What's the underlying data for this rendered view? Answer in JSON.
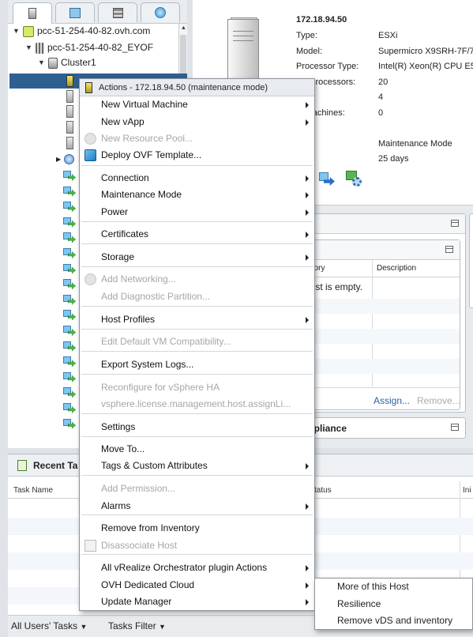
{
  "navigator": {
    "tabs": [
      {
        "name": "hosts-clusters-tab",
        "glyph": "▯"
      },
      {
        "name": "vms-templates-tab",
        "glyph": "◫"
      },
      {
        "name": "storage-tab",
        "glyph": "▤"
      },
      {
        "name": "networking-tab",
        "glyph": "◉"
      }
    ],
    "tree": {
      "vcenter": "pcc-51-254-40-82.ovh.com",
      "datacenter": "pcc-51-254-40-82_EYOF",
      "cluster": "Cluster1"
    }
  },
  "summary": {
    "host_ip": "172.18.94.50",
    "fields": [
      {
        "label": "Type:",
        "value": "ESXi"
      },
      {
        "label": "Model:",
        "value": "Supermicro X9SRH-7F/7T"
      },
      {
        "label": "Processor Type:",
        "value": "Intel(R) Xeon(R) CPU E5-"
      },
      {
        "label": "cal Processors:",
        "value": "20"
      },
      {
        "label": "",
        "value": "4"
      },
      {
        "label": "al Machines:",
        "value": "0"
      },
      {
        "label": "",
        "value": ""
      },
      {
        "label": "e:",
        "value": "Maintenance Mode"
      },
      {
        "label": "ne:",
        "value": "25 days"
      }
    ],
    "panel_list": {
      "col_category": "gory",
      "col_description": "Description",
      "empty_text": "list is empty.",
      "assign_link": "Assign...",
      "remove_link": "Remove..."
    },
    "compliance_label": "mpliance"
  },
  "tasks": {
    "title": "Recent Ta",
    "col_task_name": "Task Name",
    "col_status": "tatus",
    "col_initiator": "Ini",
    "footer_all_users": "All Users' Tasks",
    "footer_filter": "Tasks Filter"
  },
  "context_menu": {
    "header": "Actions - 172.18.94.50 (maintenance mode)",
    "items": [
      {
        "label": "New Virtual Machine",
        "enabled": true,
        "submenu": true
      },
      {
        "label": "New vApp",
        "enabled": true,
        "submenu": true
      },
      {
        "label": "New Resource Pool...",
        "enabled": false,
        "submenu": false
      },
      {
        "label": "Deploy OVF Template...",
        "enabled": true,
        "submenu": false
      },
      {
        "label": "Connection",
        "enabled": true,
        "submenu": true
      },
      {
        "label": "Maintenance Mode",
        "enabled": true,
        "submenu": true
      },
      {
        "label": "Power",
        "enabled": true,
        "submenu": true
      },
      {
        "label": "Certificates",
        "enabled": true,
        "submenu": true
      },
      {
        "label": "Storage",
        "enabled": true,
        "submenu": true
      },
      {
        "label": "Add Networking...",
        "enabled": false,
        "submenu": false
      },
      {
        "label": "Add Diagnostic Partition...",
        "enabled": false,
        "submenu": false
      },
      {
        "label": "Host Profiles",
        "enabled": true,
        "submenu": true
      },
      {
        "label": "Edit Default VM Compatibility...",
        "enabled": false,
        "submenu": false
      },
      {
        "label": "Export System Logs...",
        "enabled": true,
        "submenu": false
      },
      {
        "label": "Reconfigure for vSphere HA",
        "enabled": false,
        "submenu": false
      },
      {
        "label": "vsphere.license.management.host.assignLi...",
        "enabled": false,
        "submenu": false
      },
      {
        "label": "Settings",
        "enabled": true,
        "submenu": false
      },
      {
        "label": "Move To...",
        "enabled": true,
        "submenu": false
      },
      {
        "label": "Tags & Custom Attributes",
        "enabled": true,
        "submenu": true
      },
      {
        "label": "Add Permission...",
        "enabled": false,
        "submenu": false
      },
      {
        "label": "Alarms",
        "enabled": true,
        "submenu": true
      },
      {
        "label": "Remove from Inventory",
        "enabled": true,
        "submenu": false
      },
      {
        "label": "Disassociate Host",
        "enabled": false,
        "submenu": false
      },
      {
        "label": "All vRealize Orchestrator plugin Actions",
        "enabled": true,
        "submenu": true
      },
      {
        "label": "OVH Dedicated Cloud",
        "enabled": true,
        "submenu": true
      },
      {
        "label": "Update Manager",
        "enabled": true,
        "submenu": true
      }
    ]
  },
  "submenu": {
    "items": [
      "More of this Host",
      "Resilience",
      "Remove vDS and inventory"
    ]
  },
  "colors": {
    "selection": "#2f5f8f",
    "disabled_text": "#a6a6a6",
    "vm_icon_green": "#4cae4c",
    "vm_icon_blue": "#7fc7ee"
  }
}
